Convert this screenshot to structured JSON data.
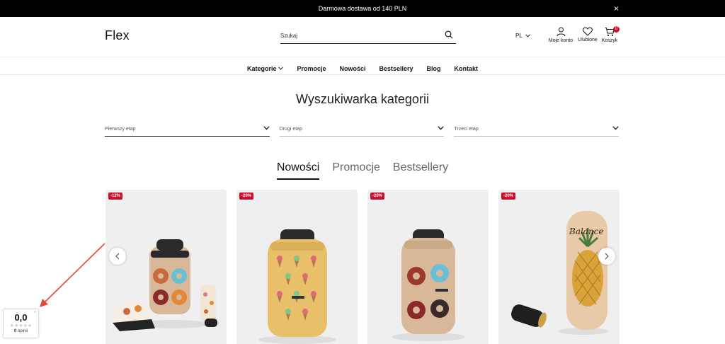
{
  "topbar": {
    "text": "Darmowa dostawa od 140 PLN",
    "close": "×"
  },
  "header": {
    "logo": "Flex",
    "search_placeholder": "Szukaj",
    "lang": "PL",
    "account_label": "Moje konto",
    "favorites_label": "Ulubione",
    "cart_label": "Koszyk",
    "cart_count": "0"
  },
  "nav": {
    "items": [
      "Kategorie",
      "Promocje",
      "Nowości",
      "Bestsellery",
      "Blog",
      "Kontakt"
    ]
  },
  "finder": {
    "title": "Wyszukiwarka kategorii",
    "filters": [
      "Pierwszy etap",
      "Drugi etap",
      "Trzeci etap"
    ]
  },
  "tabs": {
    "items": [
      "Nowości",
      "Promocje",
      "Bestsellery"
    ],
    "active": "Nowości"
  },
  "products": [
    {
      "discount": "-12%"
    },
    {
      "discount": "-20%"
    },
    {
      "discount": "-20%"
    },
    {
      "discount": "-20%"
    }
  ],
  "rating": {
    "score": "0,0",
    "stars": "★★★★★",
    "count": "0",
    "count_label": "opinii",
    "close": "×"
  },
  "colors": {
    "accent": "#c8102e",
    "topbar": "#000000"
  }
}
